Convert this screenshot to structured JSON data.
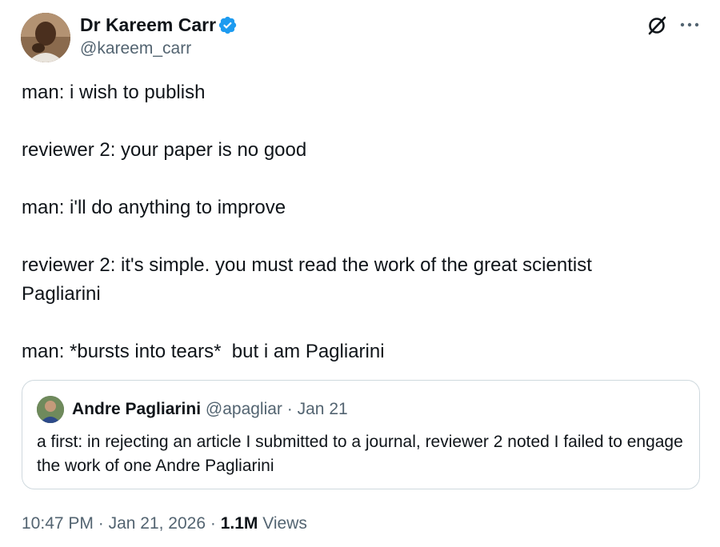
{
  "author": {
    "name": "Dr Kareem Carr",
    "handle": "@kareem_carr",
    "verified_color": "#1d9bf0"
  },
  "tweet": {
    "lines": [
      "man: i wish to publish",
      "reviewer 2: your paper is no good",
      "man: i'll do anything to improve",
      "reviewer 2: it's simple. you must read the work of the great scientist Pagliarini",
      "man: *bursts into tears*  but i am Pagliarini"
    ]
  },
  "quote": {
    "name": "Andre Pagliarini",
    "handle": "@apagliar",
    "separator": "·",
    "date": "Jan 21",
    "text": "a first: in rejecting an article I submitted to a journal, reviewer 2 noted I failed to engage the work of one Andre Pagliarini"
  },
  "footer": {
    "time": "10:47 PM",
    "date": "Jan 21, 2026",
    "separator": "·",
    "views_count": "1.1M",
    "views_label": "Views"
  },
  "icons": {
    "grok": "grok-icon",
    "more": "more-icon",
    "verified": "verified-badge-icon"
  },
  "colors": {
    "text": "#0f1419",
    "secondary": "#536471",
    "border": "#cfd9de",
    "accent": "#1d9bf0"
  }
}
